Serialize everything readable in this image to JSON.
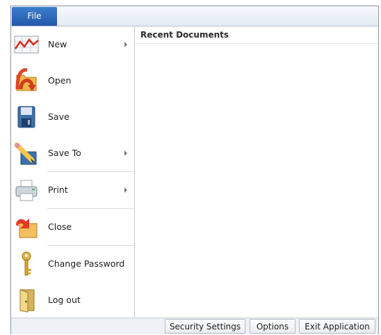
{
  "file_tab": "File",
  "menu": [
    {
      "key": "new",
      "label": "New",
      "has_submenu": true,
      "icon": "chart-icon"
    },
    {
      "key": "open",
      "label": "Open",
      "has_submenu": false,
      "icon": "open-folder-icon"
    },
    {
      "key": "save",
      "label": "Save",
      "has_submenu": false,
      "icon": "floppy-disk-icon"
    },
    {
      "key": "save-to",
      "label": "Save To",
      "has_submenu": true,
      "icon": "pencil-icon"
    },
    {
      "key": "print",
      "label": "Print",
      "has_submenu": true,
      "icon": "printer-icon"
    },
    {
      "key": "close",
      "label": "Close",
      "has_submenu": false,
      "icon": "close-folder-icon"
    },
    {
      "key": "change-password",
      "label": "Change Password",
      "has_submenu": false,
      "icon": "key-icon"
    },
    {
      "key": "log-out",
      "label": "Log out",
      "has_submenu": false,
      "icon": "door-icon"
    }
  ],
  "recent_documents": {
    "title": "Recent Documents"
  },
  "status_bar": {
    "security_settings": "Security Settings",
    "options": "Options",
    "exit_application": "Exit Application"
  },
  "colors": {
    "file_tab": "#2b63b6",
    "frame_border": "#8a96a6"
  }
}
